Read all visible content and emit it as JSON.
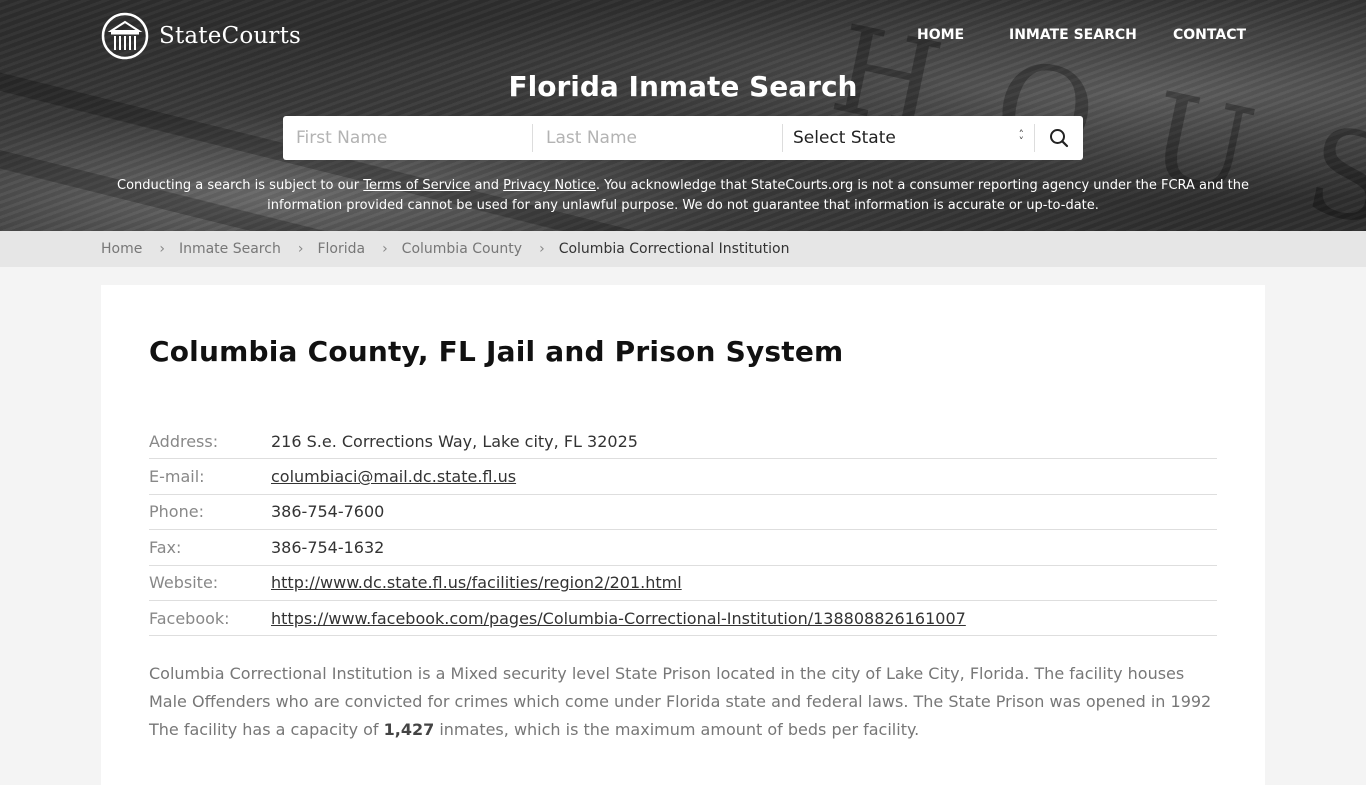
{
  "header": {
    "logo_text": "StateCourts",
    "nav": [
      "HOME",
      "INMATE SEARCH",
      "CONTACT"
    ],
    "title": "Florida Inmate Search"
  },
  "search": {
    "first_name_placeholder": "First Name",
    "last_name_placeholder": "Last Name",
    "state_selected": "Select State"
  },
  "disclaimer": {
    "pre": "Conducting a search is subject to our ",
    "terms_link": "Terms of Service",
    "and": " and ",
    "privacy_link": "Privacy Notice",
    "post_line1": ". You acknowledge that StateCourts.org is not a consumer reporting agency under the FCRA and the",
    "line2": "information provided cannot be used for any unlawful purpose. We do not guarantee that information is accurate or up-to-date."
  },
  "breadcrumb": [
    "Home",
    "Inmate Search",
    "Florida",
    "Columbia County",
    "Columbia Correctional Institution"
  ],
  "main": {
    "title": "Columbia County, FL Jail and Prison System",
    "info": [
      {
        "label": "Address:",
        "value": "216 S.e. Corrections Way, Lake city, FL 32025",
        "link": false
      },
      {
        "label": "E-mail:",
        "value": "columbiaci@mail.dc.state.fl.us",
        "link": true
      },
      {
        "label": "Phone:",
        "value": "386-754-7600",
        "link": false
      },
      {
        "label": "Fax:",
        "value": "386-754-1632",
        "link": false
      },
      {
        "label": "Website:",
        "value": "http://www.dc.state.fl.us/facilities/region2/201.html",
        "link": true
      },
      {
        "label": "Facebook:",
        "value": "https://www.facebook.com/pages/Columbia-Correctional-Institution/138808826161007",
        "link": true
      }
    ],
    "description_pre": "Columbia Correctional Institution is a Mixed security level State Prison located in the city of Lake City, Florida. The facility houses Male Offenders who are convicted for crimes which come under Florida state and federal laws. The State Prison was opened in 1992 The facility has a capacity of ",
    "capacity": "1,427",
    "description_post": " inmates, which is the maximum amount of beds per facility."
  }
}
